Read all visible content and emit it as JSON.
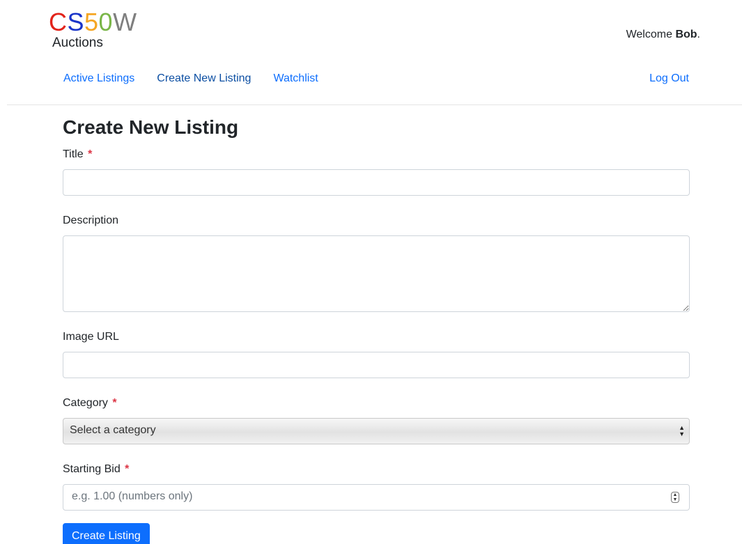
{
  "logo": {
    "letters": [
      {
        "char": "C",
        "color": "#e2231a"
      },
      {
        "char": "S",
        "color": "#1a35c9"
      },
      {
        "char": "5",
        "color": "#f5a623"
      },
      {
        "char": "0",
        "color": "#7ab648"
      },
      {
        "char": "W",
        "color": "#7f7f7f"
      }
    ],
    "subtitle": "Auctions"
  },
  "header": {
    "welcome_prefix": "Welcome ",
    "username": "Bob",
    "welcome_suffix": "."
  },
  "nav": {
    "items": [
      {
        "label": "Active Listings"
      },
      {
        "label": "Create New Listing"
      },
      {
        "label": "Watchlist"
      }
    ],
    "logout_label": "Log Out"
  },
  "form": {
    "heading": "Create New Listing",
    "title_label": "Title",
    "title_value": "",
    "description_label": "Description",
    "description_value": "",
    "image_label": "Image URL",
    "image_value": "",
    "category_label": "Category",
    "category_selected": "Select a category",
    "bid_label": "Starting Bid",
    "bid_placeholder": "e.g. 1.00 (numbers only)",
    "required_marker": "*",
    "submit_label": "Create Listing"
  },
  "colors": {
    "link": "#0d6efd",
    "primary_button": "#0d6efd",
    "required": "#dc3545"
  }
}
